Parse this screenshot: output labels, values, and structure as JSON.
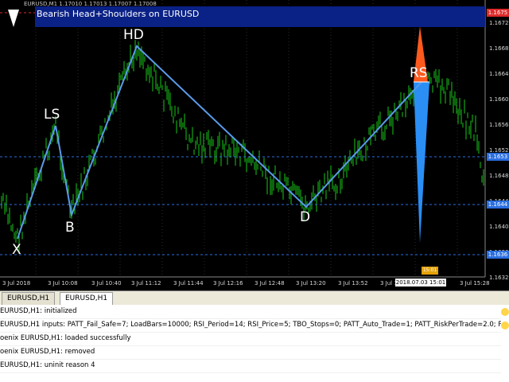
{
  "symbol_line": "EURUSD,M1  1.17010 1.17013 1.17007 1.17008",
  "banner": {
    "title": "Bearish Head+Shoulders on EURUSD"
  },
  "pattern_labels": {
    "x": "X",
    "ls": "LS",
    "b": "B",
    "hd": "HD",
    "d": "D",
    "rs": "RS"
  },
  "price_axis": [
    "1.1672",
    "1.1668",
    "1.1664",
    "1.1660",
    "1.1656",
    "1.1652",
    "1.1648",
    "1.1644",
    "1.1640",
    "1.1636",
    "1.1632"
  ],
  "price_tags": {
    "top": "1.1675",
    "blue_mid": "1.1653",
    "blue_low": "1.1644",
    "blue_bottom": "1.1636"
  },
  "time_axis": [
    "3 Jul 2018",
    "3 Jul 10:08",
    "3 Jul 10:40",
    "3 Jul 11:12",
    "3 Jul 11:44",
    "3 Jul 12:16",
    "3 Jul 12:48",
    "3 Jul 13:20",
    "3 Jul 13:52",
    "3 Jul 14:24",
    "3 Jul 15:28"
  ],
  "time_highlight": "2018.07.03 15:01",
  "time_tag": "15:01",
  "tabs": [
    {
      "label": "EURUSD,H1"
    },
    {
      "label": "EURUSD,H1"
    }
  ],
  "log": [
    "EURUSD,H1: initialized",
    "EURUSD,H1 inputs: PATT_Fail_Safe=7; LoadBars=10000; RSI_Period=14; RSI_Price=5; TBO_Stops=0; PATT_Auto_Trade=1; PATT_RiskPerTrade=2.0; PATT_T...",
    "oenix EURUSD,H1: loaded successfully",
    "oenix EURUSD,H1: removed",
    "EURUSD,H1: uninit reason 4"
  ],
  "colors": {
    "candles": "#19c919",
    "pattern_line": "#4a90e0",
    "banner": "#0a2186",
    "orange": "#ff5a1e",
    "blue": "#2a8ef5"
  }
}
